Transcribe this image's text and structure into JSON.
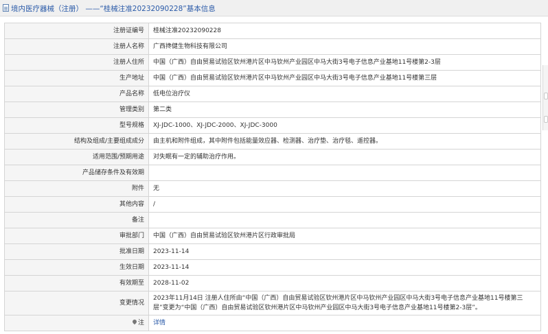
{
  "header": {
    "breadcrumb": "境内医疗器械（注册） ——“桂械注准20232090228”基本信息"
  },
  "rows": [
    {
      "label": "注册证编号",
      "value": "桂械注准20232090228"
    },
    {
      "label": "注册人名称",
      "value": "广西搀健生物科技有限公司"
    },
    {
      "label": "注册人住所",
      "value": "中国（广西）自由贸易试验区钦州港片区中马钦州产业园区中马大街3号电子信息产业基地11号楼第2-3层"
    },
    {
      "label": "生产地址",
      "value": "中国（广西）自由贸易试验区钦州港片区中马钦州产业园区中马大街3号电子信息产业基地11号楼第三层"
    },
    {
      "label": "产品名称",
      "value": "低电位治疗仪"
    },
    {
      "label": "管理类别",
      "value": "第二类"
    },
    {
      "label": "型号规格",
      "value": "XJ-JDC-1000、XJ-JDC-2000、XJ-JDC-3000"
    },
    {
      "label": "结构及组成/主要组成成分",
      "value": "由主机和附件组成，其中附件包括能量效应器、检测器、治疗垫、治疗毯、遥控器。"
    },
    {
      "label": "适用范围/预期用途",
      "value": "对失眠有一定的辅助治疗作用。"
    },
    {
      "label": "产品储存条件及有效期",
      "value": ""
    },
    {
      "label": "附件",
      "value": "无"
    },
    {
      "label": "其他内容",
      "value": "/"
    },
    {
      "label": "备注",
      "value": ""
    },
    {
      "label": "审批部门",
      "value": "中国（广西）自由贸易试验区钦州港片区行政审批局"
    },
    {
      "label": "批准日期",
      "value": "2023-11-14"
    },
    {
      "label": "生效日期",
      "value": "2023-11-14"
    },
    {
      "label": "有效期至",
      "value": "2028-11-02"
    },
    {
      "label": "变更情况",
      "value": "2023年11月14日 注册人住所由“中国（广西）自由贸易试验区钦州港片区中马钦州产业园区中马大街3号电子信息产业基地11号楼第三层”变更为“中国（广西）自由贸易试验区钦州港片区中马钦州产业园区中马大街3号电子信息产业基地11号楼第2-3层”。"
    }
  ],
  "note_row": {
    "label": "注",
    "link": "详情"
  }
}
